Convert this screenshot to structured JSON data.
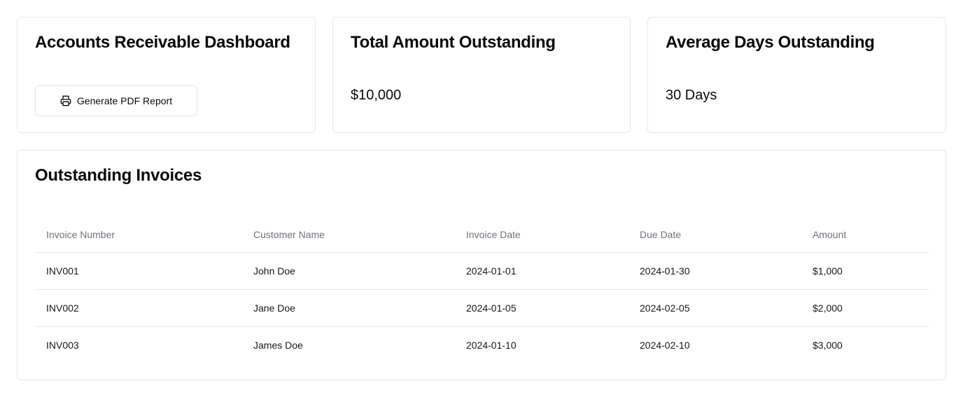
{
  "dashboard_card": {
    "title": "Accounts Receivable Dashboard",
    "generate_button_label": "Generate PDF Report",
    "generate_button_icon": "printer-icon"
  },
  "total_card": {
    "title": "Total Amount Outstanding",
    "value": "$10,000"
  },
  "average_card": {
    "title": "Average Days Outstanding",
    "value": "30 Days"
  },
  "invoices": {
    "title": "Outstanding Invoices",
    "columns": [
      "Invoice Number",
      "Customer Name",
      "Invoice Date",
      "Due Date",
      "Amount"
    ],
    "rows": [
      [
        "INV001",
        "John Doe",
        "2024-01-01",
        "2024-01-30",
        "$1,000"
      ],
      [
        "INV002",
        "Jane Doe",
        "2024-01-05",
        "2024-02-05",
        "$2,000"
      ],
      [
        "INV003",
        "James Doe",
        "2024-01-10",
        "2024-02-10",
        "$3,000"
      ]
    ]
  },
  "colors": {
    "border": "#e5e7eb",
    "header_text": "#71717a",
    "text": "#0a0a0a"
  }
}
